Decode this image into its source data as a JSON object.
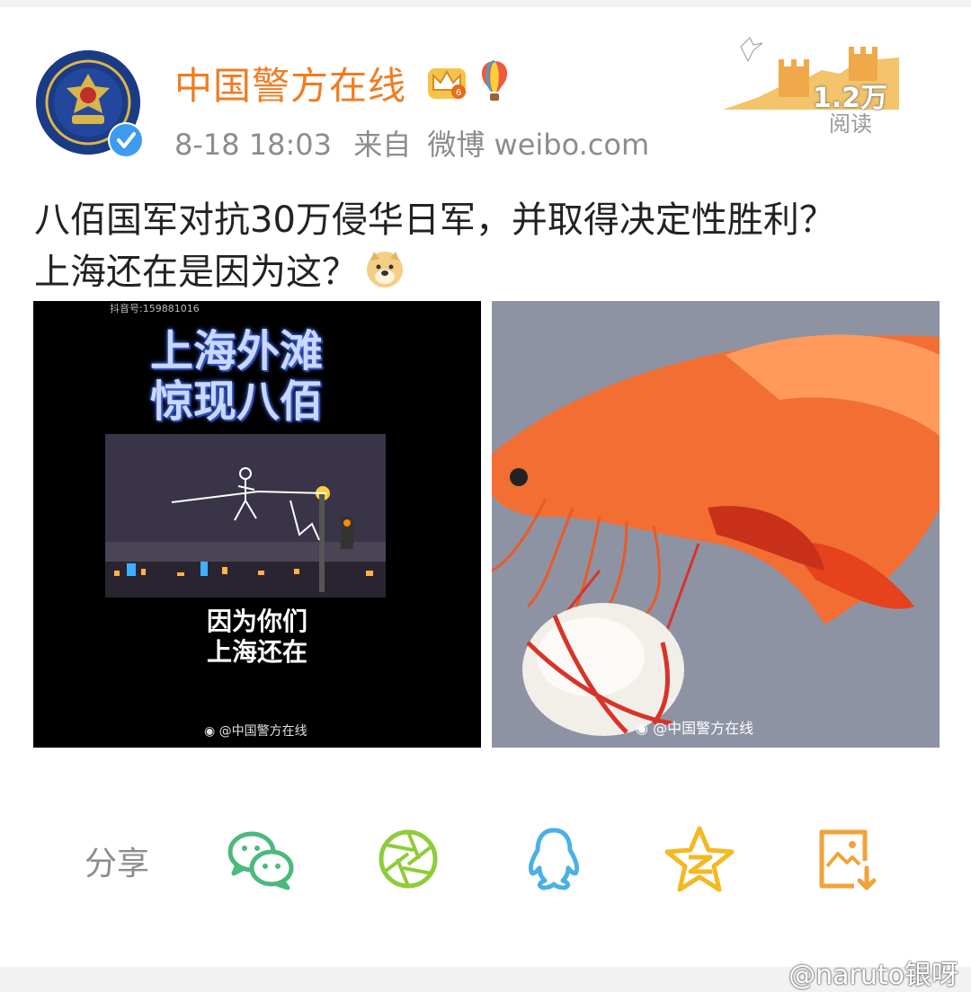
{
  "post": {
    "username": "中国警方在线",
    "date": "8-18 18:03",
    "source_prefix": "来自",
    "source": "微博 weibo.com",
    "reads_count": "1.2万",
    "reads_label": "阅读",
    "text_line1": "八佰国军对抗30万侵华日军，并取得决定性胜利？",
    "text_line2": "上海还在是因为这？"
  },
  "images": {
    "left": {
      "tiny_text": "抖音号:159881016",
      "headline_line1": "上海外滩",
      "headline_line2": "惊现八佰",
      "caption_line1": "因为你们",
      "caption_line2": "上海还在",
      "watermark": "@中国警方在线"
    },
    "right": {
      "watermark": "@中国警方在线"
    }
  },
  "share": {
    "label": "分享",
    "icons": [
      "wechat-icon",
      "moments-icon",
      "qq-icon",
      "qzone-icon",
      "save-image-icon"
    ]
  },
  "footer": {
    "watermark": "@naruto银呀"
  },
  "colors": {
    "username": "#f07c22",
    "meta": "#8c8c8c",
    "wechat": "#4cb97e",
    "moments": "#8fcc3a",
    "qq": "#4ab0e8",
    "qzone": "#f5b820",
    "save": "#f2a23a"
  }
}
